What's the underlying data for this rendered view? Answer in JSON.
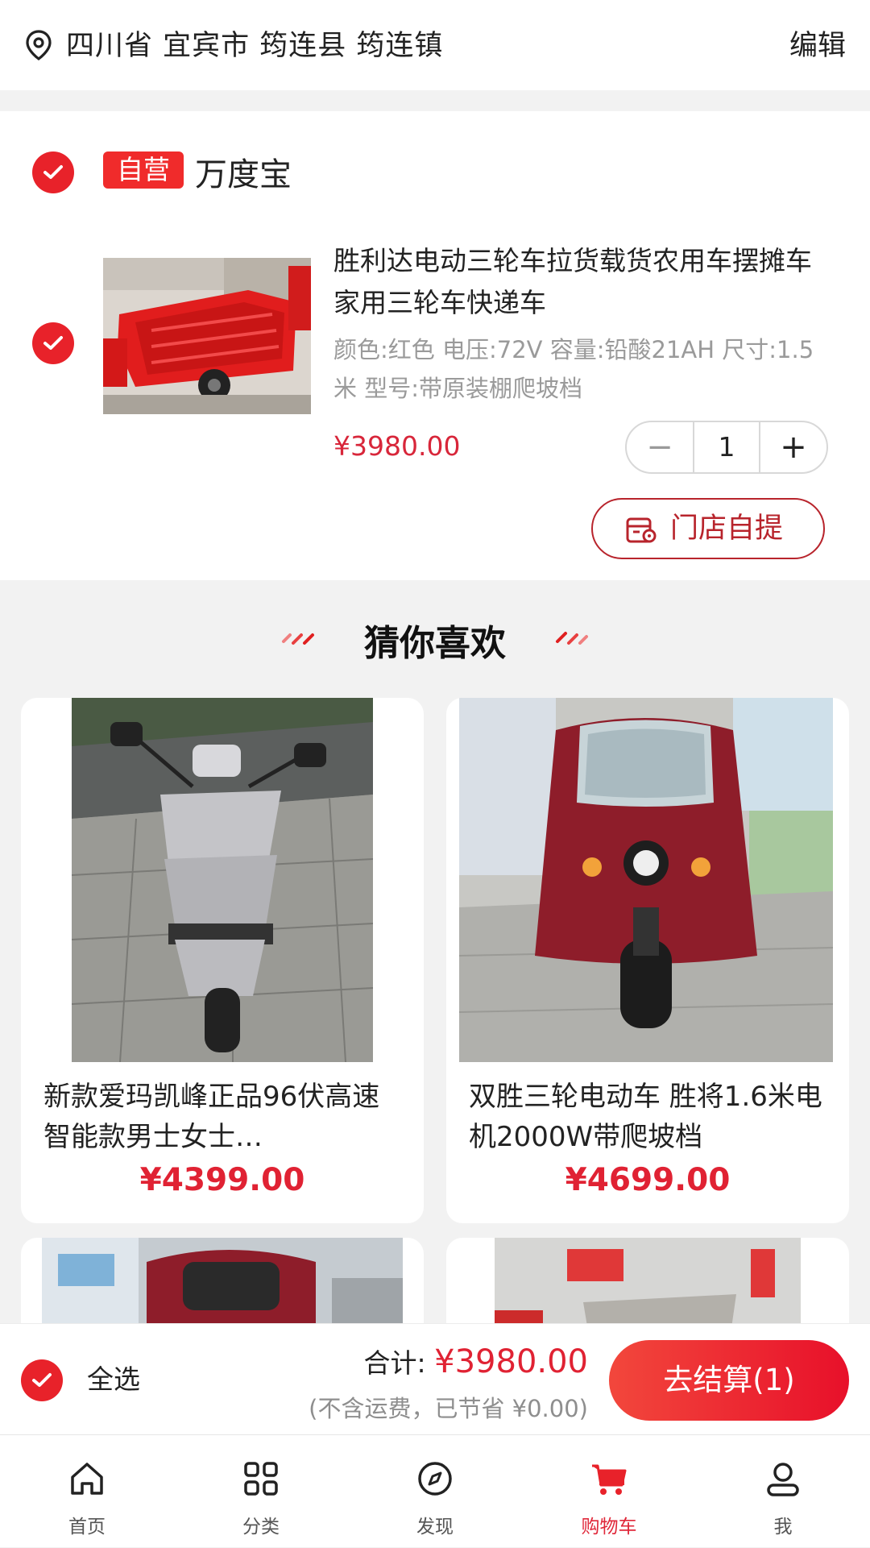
{
  "address": {
    "text": "四川省 宜宾市 筠连县 筠连镇",
    "edit_label": "编辑"
  },
  "shop": {
    "tag": "自营",
    "name": "万度宝"
  },
  "cart_item": {
    "title": "胜利达电动三轮车拉货载货农用车摆摊车家用三轮车快递车",
    "spec": "颜色:红色 电压:72V 容量:铅酸21AH 尺寸:1.5米 型号:带原装棚爬坡档",
    "price": "¥3980.00",
    "quantity": "1",
    "minus": "−",
    "plus": "+",
    "pickup_label": "门店自提"
  },
  "recommend": {
    "title": "猜你喜欢",
    "items": [
      {
        "title": "新款爱玛凯峰正品96伏高速智能款男士女士…",
        "price": "¥4399.00"
      },
      {
        "title": "双胜三轮电动车 胜将1.6米电机2000W带爬坡档",
        "price": "¥4699.00"
      }
    ]
  },
  "checkout": {
    "select_all": "全选",
    "total_label": "合计:",
    "total_amount": "¥3980.00",
    "note": "(不含运费，已节省 ¥0.00)",
    "pay_label": "去结算(1)"
  },
  "tabbar": {
    "items": [
      {
        "label": "首页",
        "icon": "home-icon"
      },
      {
        "label": "分类",
        "icon": "category-grid-icon"
      },
      {
        "label": "发现",
        "icon": "compass-icon"
      },
      {
        "label": "购物车",
        "icon": "shopping-cart-icon"
      },
      {
        "label": "我",
        "icon": "user-icon"
      }
    ],
    "active_index": 3
  },
  "colors": {
    "accent": "#e8222a",
    "price": "#e02233",
    "pickup_border": "#b8242c"
  }
}
